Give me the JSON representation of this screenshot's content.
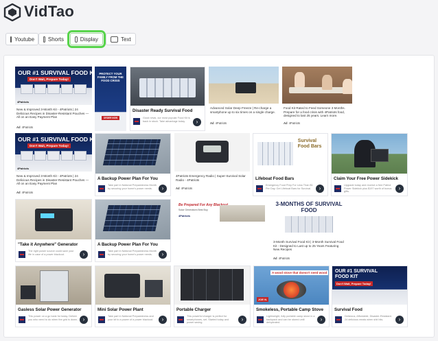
{
  "app": {
    "name": "VidTao"
  },
  "tabs": [
    {
      "label": "Youtube",
      "icon": "youtube-icon"
    },
    {
      "label": "Shorts",
      "icon": "shorts-icon"
    },
    {
      "label": "Display",
      "icon": "display-icon",
      "active": true
    },
    {
      "label": "Text",
      "icon": "text-icon"
    }
  ],
  "colors": {
    "active_outline": "#57d44a",
    "navy": "#1d2a64",
    "ad_red": "#c62828"
  },
  "ads": {
    "r1c1": {
      "art_title": "OUR #1 SURVIVAL FOOD KIT",
      "art_sub": "Don't Wait, Prepare Today!",
      "art_brand": "4Patriots",
      "caption": "New & Improved 3-Month Kit - 4Patriots | 24 Delicious Recipes in Disaster-Resistant Pouches — All on an Easy Payment Plan",
      "ad_label": "Ad",
      "sponsor": "4Patriots"
    },
    "r1c2": {
      "art_text": "PROTECT YOUR FAMILY FROM THE FOOD CRISIS",
      "button": "ORDER NOW"
    },
    "r1c3": {
      "headline": "Disaster Ready Survival Food",
      "blurb": "Good news, our most popular Food Kit is back in stock. Take advantage today."
    },
    "r1c4": {
      "caption": "Advanced Solar Deep Freeze | Re-charge a smartphone up to six times on a single charge.",
      "ad_label": "Ad",
      "sponsor": "4Patriots"
    },
    "r1c5": {
      "caption": "Food Kit Rated to Feed Someone 3 Months. Prepare for a food crisis with 4Patriots food, designed to last 25 years. Learn more.",
      "ad_label": "Ad",
      "sponsor": "4Patriots"
    },
    "r2c1": {
      "art_title": "OUR #1 SURVIVAL FOOD KIT",
      "art_sub": "Don't Wait, Prepare Today!",
      "art_brand": "4Patriots",
      "caption": "New & Improved 3-Month Kit - 4Patriots | 24 Delicious Recipes in Disaster-Resistant Pouches — All on an Easy Payment Plan",
      "ad_label": "Ad",
      "sponsor": "4Patriots"
    },
    "r2c2": {
      "headline": "A Backup Power Plan For You",
      "blurb": "Take part in National Preparedness Month by securing your home's power needs."
    },
    "r2c3": {
      "caption": "4Patriots Emergency Radio | Super-Survival Solar Radio - 4Patriots",
      "ad_label": "Ad",
      "sponsor": "4Patriots"
    },
    "r2c4": {
      "art_title": "Survival Food Bars",
      "headline": "Lifeboat Food Bars",
      "blurb": "Emergency Food Prep For Less Than $1 Per Day. Get Lifeboat Bars for Survival."
    },
    "r2c5": {
      "headline": "Claim Your Free Power Sidekick",
      "blurb": "Upgrade today and receive a free Patriot Power Sidekick plus $197 worth of bonus gifts."
    },
    "r3c1": {
      "headline": "\"Take it Anywhere\" Generator",
      "blurb": "The right power source could save your life in case of a power blackout."
    },
    "r3c2": {
      "headline": "A Backup Power Plan For You",
      "blurb": "Take part in National Preparedness Month by securing your home's power needs."
    },
    "r3c3": {
      "art_title": "Be Prepared For Any Blackout",
      "art_sub": "Solar Generators Best Buy",
      "art_brand": "4Patriots"
    },
    "r3c4": {
      "art_title": "3-MONTHS OF SURVIVAL FOOD",
      "caption": "3-Month Survival Food Kit | 3-Month Survival Food Kit - Designed to Last up to 25 Years Featuring New Recipes",
      "ad_label": "Ad",
      "sponsor": "4Patriots"
    },
    "r4c1": {
      "headline": "Gasless Solar Power Generator",
      "blurb": "This power on a go bank for today. Deliver you who need to do when the grid is down."
    },
    "r4c2": {
      "headline": "Mini Solar Power Plant",
      "blurb": "Take part in National Preparedness and your kit to a power of a power blackout."
    },
    "r4c3": {
      "headline": "Portable Charger",
      "blurb": "This powerful charger is perfect for smartphones, set. Started today and power saving."
    },
    "r4c4": {
      "art_title": "A wood stove that doesn't need wood",
      "art_name": "JOE N.",
      "headline": "Smokeless, Portable Camp Stove",
      "blurb": "Lightweight, fully portable camp stove in a backpack and can be stored until dehydrated."
    },
    "r4c5": {
      "art_title": "OUR #1 SURVIVAL FOOD KIT",
      "art_sub": "Don't Wait, Prepare Today!",
      "headline": "Survival Food",
      "blurb": "Delicious, Affordable, Disaster-Resistant. 24 delicious meals when shit hits."
    }
  },
  "go_glyph": "›"
}
